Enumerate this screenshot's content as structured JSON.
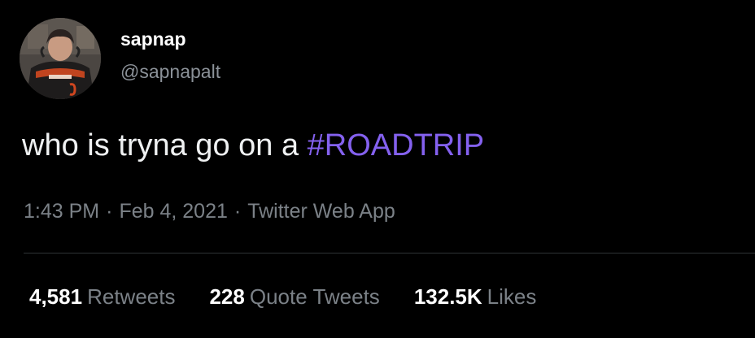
{
  "tweet": {
    "author": {
      "display_name": "sapnap",
      "handle": "@sapnapalt"
    },
    "text": {
      "body": "who is tryna go on a ",
      "hashtag": "#ROADTRIP"
    },
    "meta": {
      "time": "1:43 PM",
      "separator": "·",
      "date": "Feb 4, 2021",
      "source": "Twitter Web App"
    },
    "stats": [
      {
        "count": "4,581",
        "label": "Retweets"
      },
      {
        "count": "228",
        "label": "Quote Tweets"
      },
      {
        "count": "132.5K",
        "label": "Likes"
      }
    ]
  },
  "colors": {
    "background": "#000000",
    "text": "#eff1f2",
    "secondary_text": "#7b8187",
    "hashtag": "#8461ef",
    "divider": "#2f3336"
  }
}
